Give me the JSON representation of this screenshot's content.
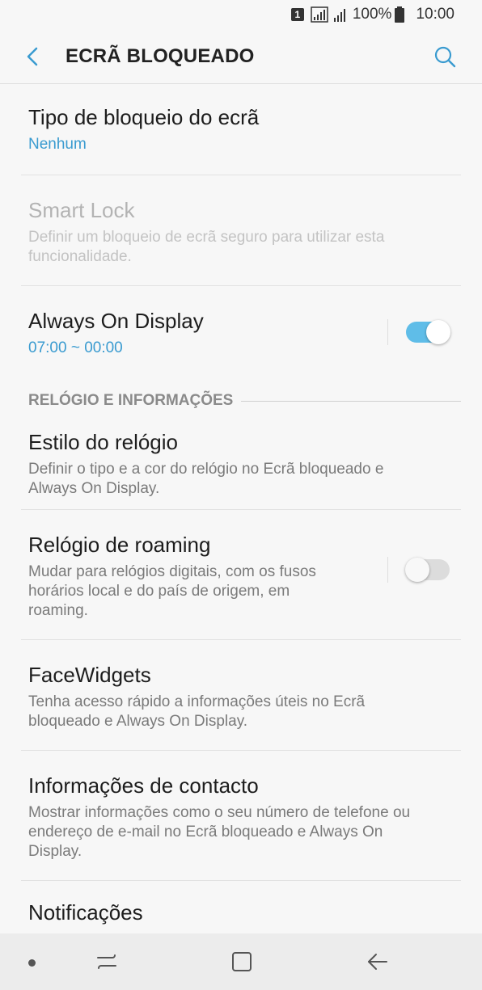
{
  "status": {
    "sim": "1",
    "battery": "100%",
    "time": "10:00"
  },
  "header": {
    "title": "ECRÃ BLOQUEADO"
  },
  "items": {
    "lock_type": {
      "title": "Tipo de bloqueio do ecrã",
      "sub": "Nenhum"
    },
    "smart_lock": {
      "title": "Smart Lock",
      "sub": "Definir um bloqueio de ecrã seguro para utilizar esta funcionalidade."
    },
    "aod": {
      "title": "Always On Display",
      "sub": "07:00 ~ 00:00",
      "enabled": true
    },
    "section": "RELÓGIO E INFORMAÇÕES",
    "clock_style": {
      "title": "Estilo do relógio",
      "sub": "Definir o tipo e a cor do relógio no Ecrã bloqueado e Always On Display."
    },
    "roaming_clock": {
      "title": "Relógio de roaming",
      "sub": "Mudar para relógios digitais, com os fusos horários local e do país de origem, em roaming.",
      "enabled": false
    },
    "facewidgets": {
      "title": "FaceWidgets",
      "sub": "Tenha acesso rápido a informações úteis no Ecrã bloqueado e Always On Display."
    },
    "contact_info": {
      "title": "Informações de contacto",
      "sub": "Mostrar informações como o seu número de telefone ou endereço de e-mail no Ecrã bloqueado e Always On Display."
    },
    "notifications": {
      "title": "Notificações"
    }
  },
  "colors": {
    "accent": "#3a9bd0",
    "toggle_on": "#5fbde8"
  }
}
